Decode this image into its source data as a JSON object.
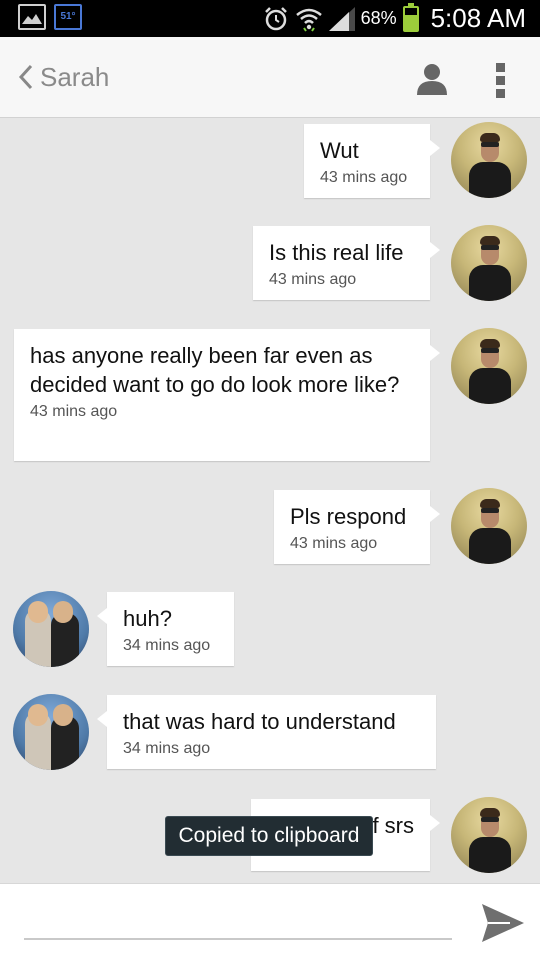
{
  "status_bar": {
    "weather_temp": "51°",
    "battery_pct_text": "68%",
    "battery_level": 0.68,
    "time": "5:08 AM",
    "icons": [
      "gallery-icon",
      "weather-icon",
      "alarm-icon",
      "wifi-icon",
      "signal-icon",
      "battery-icon"
    ]
  },
  "header": {
    "back_icon": "chevron-left-icon",
    "title": "Sarah",
    "contact_icon": "person-icon",
    "menu_icon": "overflow-menu-icon"
  },
  "messages": [
    {
      "from": "me",
      "text": "Wut",
      "time": "43 mins ago"
    },
    {
      "from": "me",
      "text": "Is this real life",
      "time": "43 mins ago"
    },
    {
      "from": "me",
      "text": "has anyone really been far even as decided want to go do look more like?",
      "time": "43 mins ago"
    },
    {
      "from": "me",
      "text": "Pls respond",
      "time": "43 mins ago"
    },
    {
      "from": "them",
      "text": "huh?",
      "time": "34 mins ago"
    },
    {
      "from": "them",
      "text": "that was hard to understand",
      "time": "34 mins ago"
    },
    {
      "from": "me",
      "text": "f srs",
      "time": ""
    }
  ],
  "toast": "Copied to clipboard",
  "composer": {
    "placeholder": "",
    "send_icon": "send-icon"
  },
  "colors": {
    "background": "#e6e6e6",
    "battery": "#9ccd3b",
    "weather_badge": "#4a78d6",
    "toast_bg": "#222d33"
  }
}
